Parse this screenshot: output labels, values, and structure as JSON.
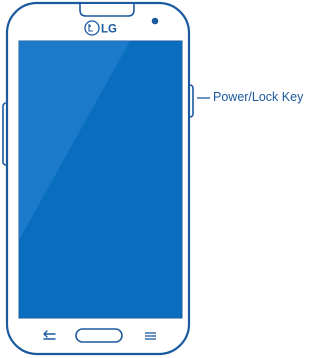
{
  "brand": {
    "logo_text": "LG"
  },
  "callouts": [
    {
      "label": "Power/Lock Key"
    }
  ],
  "icons": {
    "back": "back-arrow-icon",
    "home": "home-pill-icon",
    "menu": "menu-lines-icon"
  },
  "colors": {
    "outline": "#1c5aa0",
    "screen": "#0a6ec0",
    "screen_highlight": "#2a86d1",
    "label": "#1c5aa0"
  }
}
